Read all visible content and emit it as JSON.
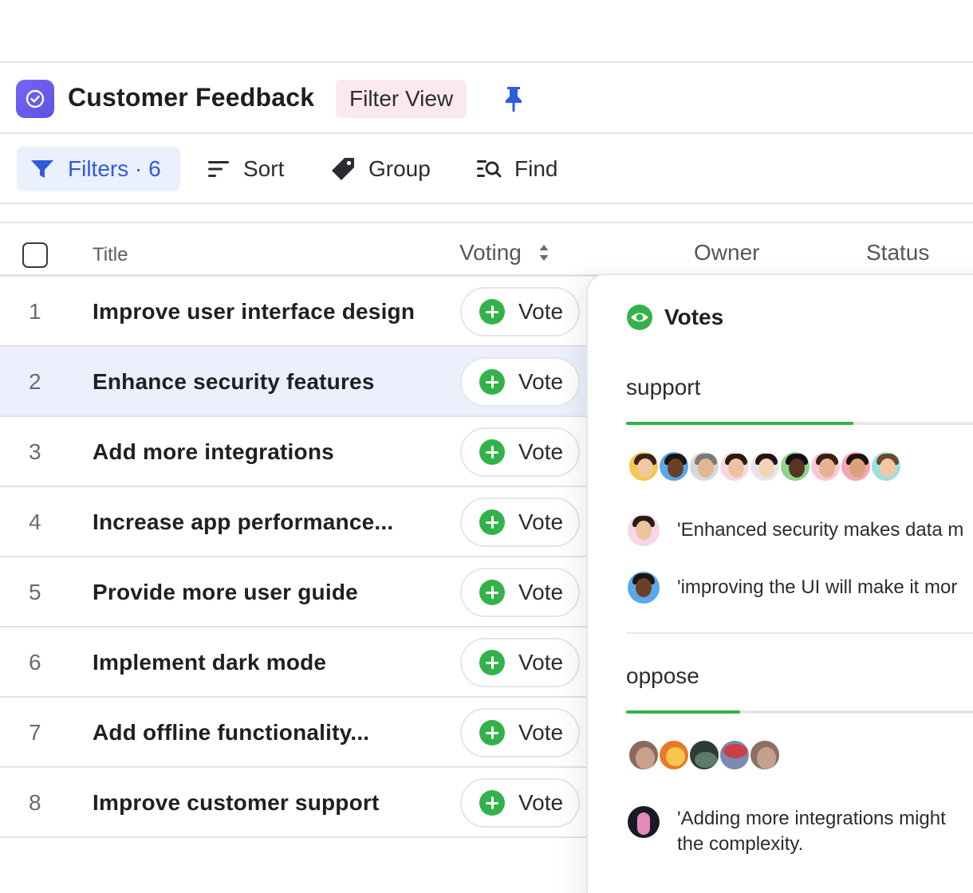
{
  "header": {
    "title": "Customer Feedback",
    "view_badge": "Filter View"
  },
  "toolbar": {
    "filters_label": "Filters · 6",
    "sort_label": "Sort",
    "group_label": "Group",
    "find_label": "Find"
  },
  "table": {
    "columns": [
      "Title",
      "Voting",
      "Owner",
      "Status"
    ],
    "vote_label": "Vote",
    "rows": [
      {
        "num": "1",
        "title": "Improve user interface design"
      },
      {
        "num": "2",
        "title": "Enhance security features"
      },
      {
        "num": "3",
        "title": "Add more integrations"
      },
      {
        "num": "4",
        "title": "Increase app performance..."
      },
      {
        "num": "5",
        "title": "Provide more user guide"
      },
      {
        "num": "6",
        "title": "Implement dark mode"
      },
      {
        "num": "7",
        "title": "Add offline functionality..."
      },
      {
        "num": "8",
        "title": "Improve customer support"
      }
    ],
    "selected_row": 1
  },
  "votes_panel": {
    "title": "Votes",
    "support": {
      "label": "support",
      "progress": 0.62,
      "comments": [
        "'Enhanced security makes data m",
        "'improving the UI will make it mor"
      ]
    },
    "oppose": {
      "label": "oppose",
      "progress": 0.31,
      "comments": [
        "'Adding more integrations might",
        "the complexity."
      ]
    }
  },
  "colors": {
    "accent_blue": "#2f5bdf",
    "vote_green": "#33b24a",
    "app_icon": "#6b5bef",
    "badge_pink": "#fce9ef",
    "selected_row": "#ebf0fc"
  },
  "icons": {
    "app": "check-circle-icon",
    "pin": "pin-icon",
    "filter": "funnel-icon",
    "sort": "sort-lines-icon",
    "group": "tag-icon",
    "find": "find-list-icon",
    "votes": "eye-icon",
    "vote": "plus-circle-icon"
  }
}
